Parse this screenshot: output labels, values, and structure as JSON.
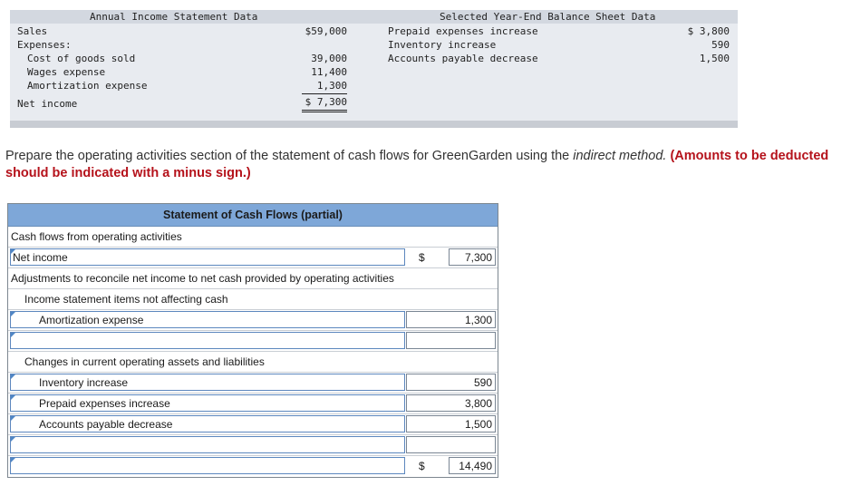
{
  "income_statement": {
    "header": "Annual Income Statement Data",
    "sales_label": "Sales",
    "sales_value": "$59,000",
    "expenses_label": "Expenses:",
    "cogs_label": "Cost of goods sold",
    "cogs_value": "39,000",
    "wages_label": "Wages expense",
    "wages_value": "11,400",
    "amort_label": "Amortization expense",
    "amort_value": "1,300",
    "net_label": "Net income",
    "net_value": "$ 7,300"
  },
  "balance_sheet": {
    "header": "Selected Year-End Balance Sheet Data",
    "prepaid_label": "Prepaid expenses increase",
    "prepaid_value": "$ 3,800",
    "inventory_label": "Inventory increase",
    "inventory_value": "590",
    "ap_label": "Accounts payable decrease",
    "ap_value": "1,500"
  },
  "instruction": {
    "text_a": "Prepare the operating activities section of the statement of cash flows for GreenGarden using the ",
    "text_em": "indirect method.",
    "hint": "(Amounts to be deducted should be indicated with a minus sign.)"
  },
  "statement": {
    "title": "Statement of Cash Flows (partial)",
    "section": "Cash flows from operating activities",
    "net_income_label": "Net income",
    "dollar_sign": "$",
    "net_income_value": "7,300",
    "adjustments_label": "Adjustments to reconcile net income to net cash provided by operating activities",
    "non_cash_label": "Income statement items not affecting cash",
    "amort_label": "Amortization expense",
    "amort_value": "1,300",
    "changes_label": "Changes in current operating assets and liabilities",
    "inventory_label": "Inventory increase",
    "inventory_value": "590",
    "prepaid_label": "Prepaid expenses increase",
    "prepaid_value": "3,800",
    "ap_label": "Accounts payable decrease",
    "ap_value": "1,500",
    "total_value": "14,490"
  }
}
